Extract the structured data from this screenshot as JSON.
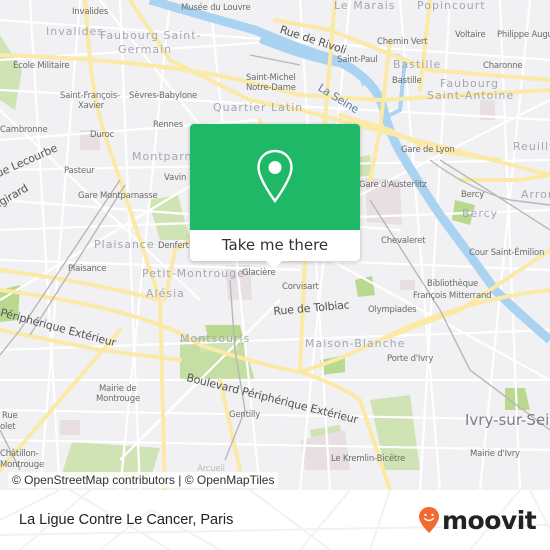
{
  "map": {
    "colors": {
      "background": "#f1f0f2",
      "major_road": "#fbe9a6",
      "minor_road": "#ffffff",
      "water": "#aad3f2",
      "park": "#cfe3b4",
      "park_dark": "#b9d98f",
      "landuse_pink": "#e8dfe3",
      "rail": "#b8b8b8"
    },
    "labels": {
      "invalides_station": "Invalides",
      "invalides_district": "Invalides",
      "musee_louvre": "Musée du Louvre",
      "faubourg_st_germain_1": "Faubourg Saint-",
      "faubourg_st_germain_2": "Germain",
      "le_marais": "Le Marais",
      "popincourt": "Popincourt",
      "rue_de_rivoli": "Rue de Rivoli",
      "chemin_vert": "Chemin Vert",
      "voltaire": "Voltaire",
      "philippe_auguste": "Philippe Auguste",
      "ecole_militaire": "École Militaire",
      "saint_paul": "Saint-Paul",
      "bastille_district": "Bastille",
      "bastille_station": "Bastille",
      "charonne": "Charonne",
      "saint_michel_1": "Saint-Michel",
      "saint_michel_2": "Notre-Dame",
      "faubourg_st_antoine_1": "Faubourg",
      "faubourg_st_antoine_2": "Saint-Antoine",
      "la_seine": "La Seine",
      "st_francois_1": "Saint-François-",
      "st_francois_2": "Xavier",
      "sevres_babylone": "Sèvres-Babylone",
      "quartier_latin": "Quartier Latin",
      "cambronne": "Cambronne",
      "duroc": "Duroc",
      "rennes": "Rennes",
      "gare_de_lyon": "Gare de Lyon",
      "reuilly": "Reuilly",
      "montparnasse": "Montparnasse",
      "rue_lecourbe": "Rue Lecourbe",
      "pasteur": "Pasteur",
      "vavin": "Vavin",
      "vaugirard": "Vaugirard",
      "gare_montparnasse": "Gare Montparnasse",
      "gare_austerlitz": "Gare d'Austerlitz",
      "bercy_station": "Bercy",
      "bercy_district": "Bercy",
      "arrondissement": "Arron",
      "plaisance_district": "Plaisance",
      "denfert": "Denfert",
      "chevaleret": "Chevaleret",
      "cour_st_emilion": "Cour Saint-Émilion",
      "plaisance_station": "Plaisance",
      "petit_montrouge": "Petit-Montrouge",
      "glaciere": "Glacière",
      "bibliotheque_1": "Bibliothèque",
      "bibliotheque_2": "François Mitterrand",
      "corvisart": "Corvisart",
      "alesia": "Alésia",
      "rue_de_tolbiac": "Rue de Tolbiac",
      "olympiades": "Olympiades",
      "periph_west": "Périphérique Extérieur",
      "montsouris": "Montsouris",
      "maison_blanche": "Maison-Blanche",
      "porte_ivry": "Porte d'Ivry",
      "boulevard_periph": "Boulevard Périphérique Extérieur",
      "mairie_montrouge_1": "Mairie de",
      "mairie_montrouge_2": "Montrouge",
      "ivry_sur_seine": "Ivry-sur-Seine",
      "gentilly": "Gentilly",
      "rue_violet_1": "Rue",
      "rue_violet_2": "olet",
      "chatillon_1": "Châtillon-",
      "chatillon_2": "Montrouge",
      "kremlin_bicetre": "Le Kremlin-Bicêtre",
      "mairie_ivry": "Mairie d'Ivry",
      "arcueil": "Arcueil"
    },
    "attribution": "© OpenStreetMap contributors | © OpenMapTiles"
  },
  "popup": {
    "icon": "map-pin-icon",
    "action_label": "Take me there",
    "accent_color": "#1fb866"
  },
  "footer": {
    "place_name": "La Ligue Contre Le Cancer, Paris",
    "brand": {
      "name": "moovit",
      "icon": "moovit-smiley-pin-icon",
      "accent_color": "#f26a2e"
    }
  }
}
